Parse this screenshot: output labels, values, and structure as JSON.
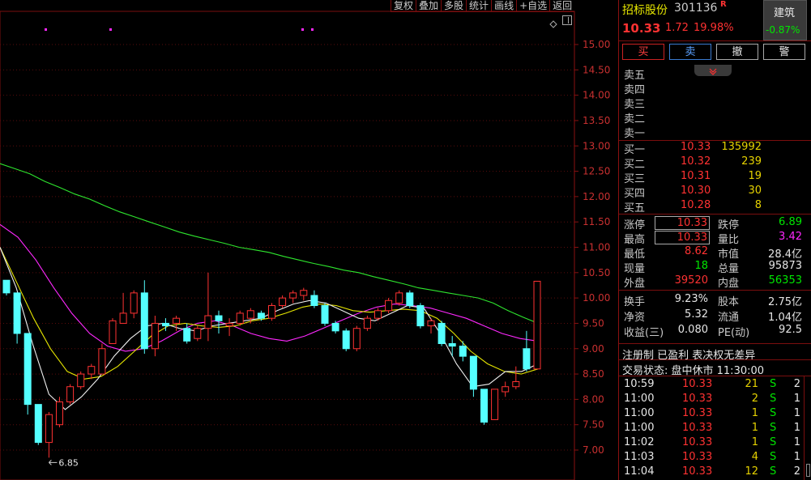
{
  "toolbar": [
    "复权",
    "叠加",
    "多股",
    "统计",
    "画线",
    "+自选",
    "返回"
  ],
  "chart": {
    "y_ticks": [
      "15.00",
      "14.50",
      "14.00",
      "13.50",
      "13.00",
      "12.50",
      "12.00",
      "11.50",
      "11.00",
      "10.50",
      "10.00",
      "9.50",
      "9.00",
      "8.50",
      "8.00",
      "7.50",
      "7.00"
    ],
    "low_marker": "6.85",
    "pin_icon": "diamond-icon"
  },
  "chart_data": {
    "type": "candlestick",
    "y_range": [
      6.7,
      15.2
    ],
    "candles": [
      {
        "o": 10.35,
        "h": 10.35,
        "l": 10.05,
        "c": 10.1
      },
      {
        "o": 10.1,
        "h": 10.1,
        "l": 9.1,
        "c": 9.3
      },
      {
        "o": 9.3,
        "h": 9.3,
        "l": 7.7,
        "c": 7.9
      },
      {
        "o": 7.9,
        "h": 7.9,
        "l": 7.1,
        "c": 7.15
      },
      {
        "o": 7.15,
        "h": 7.75,
        "l": 6.85,
        "c": 7.7
      },
      {
        "o": 7.5,
        "h": 8.05,
        "l": 7.45,
        "c": 7.95
      },
      {
        "o": 7.95,
        "h": 8.3,
        "l": 7.9,
        "c": 8.25
      },
      {
        "o": 8.25,
        "h": 8.55,
        "l": 8.2,
        "c": 8.5
      },
      {
        "o": 8.5,
        "h": 8.7,
        "l": 8.4,
        "c": 8.65
      },
      {
        "o": 8.5,
        "h": 9.1,
        "l": 8.5,
        "c": 9.0
      },
      {
        "o": 9.1,
        "h": 9.6,
        "l": 9.1,
        "c": 9.55
      },
      {
        "o": 9.5,
        "h": 10.1,
        "l": 9.5,
        "c": 9.7
      },
      {
        "o": 9.7,
        "h": 10.15,
        "l": 9.6,
        "c": 10.1
      },
      {
        "o": 10.1,
        "h": 10.35,
        "l": 8.9,
        "c": 9.0
      },
      {
        "o": 9.0,
        "h": 9.65,
        "l": 8.85,
        "c": 9.5
      },
      {
        "o": 9.5,
        "h": 9.6,
        "l": 9.35,
        "c": 9.45
      },
      {
        "o": 9.5,
        "h": 9.65,
        "l": 9.35,
        "c": 9.6
      },
      {
        "o": 9.4,
        "h": 9.5,
        "l": 9.1,
        "c": 9.15
      },
      {
        "o": 9.2,
        "h": 9.45,
        "l": 9.15,
        "c": 9.4
      },
      {
        "o": 9.4,
        "h": 10.5,
        "l": 9.15,
        "c": 9.65
      },
      {
        "o": 9.65,
        "h": 9.75,
        "l": 9.3,
        "c": 9.55
      },
      {
        "o": 9.45,
        "h": 9.6,
        "l": 9.25,
        "c": 9.5
      },
      {
        "o": 9.5,
        "h": 9.75,
        "l": 9.45,
        "c": 9.7
      },
      {
        "o": 9.6,
        "h": 9.8,
        "l": 9.5,
        "c": 9.75
      },
      {
        "o": 9.7,
        "h": 9.75,
        "l": 9.55,
        "c": 9.6
      },
      {
        "o": 9.6,
        "h": 9.9,
        "l": 9.55,
        "c": 9.85
      },
      {
        "o": 9.85,
        "h": 10.05,
        "l": 9.8,
        "c": 10.0
      },
      {
        "o": 10.0,
        "h": 10.15,
        "l": 9.9,
        "c": 10.1
      },
      {
        "o": 10.05,
        "h": 10.2,
        "l": 9.95,
        "c": 10.15
      },
      {
        "o": 10.05,
        "h": 10.15,
        "l": 9.8,
        "c": 9.85
      },
      {
        "o": 9.85,
        "h": 9.9,
        "l": 9.45,
        "c": 9.5
      },
      {
        "o": 9.5,
        "h": 9.55,
        "l": 9.3,
        "c": 9.35
      },
      {
        "o": 9.35,
        "h": 9.4,
        "l": 8.95,
        "c": 9.0
      },
      {
        "o": 9.0,
        "h": 9.45,
        "l": 8.95,
        "c": 9.4
      },
      {
        "o": 9.4,
        "h": 9.65,
        "l": 9.35,
        "c": 9.6
      },
      {
        "o": 9.6,
        "h": 9.8,
        "l": 9.55,
        "c": 9.75
      },
      {
        "o": 9.75,
        "h": 10.0,
        "l": 9.7,
        "c": 9.95
      },
      {
        "o": 9.9,
        "h": 10.15,
        "l": 9.85,
        "c": 10.1
      },
      {
        "o": 10.1,
        "h": 10.15,
        "l": 9.8,
        "c": 9.85
      },
      {
        "o": 9.85,
        "h": 9.9,
        "l": 9.4,
        "c": 9.45
      },
      {
        "o": 9.45,
        "h": 9.6,
        "l": 9.3,
        "c": 9.55
      },
      {
        "o": 9.5,
        "h": 9.55,
        "l": 9.05,
        "c": 9.1
      },
      {
        "o": 9.1,
        "h": 9.25,
        "l": 8.85,
        "c": 9.05
      },
      {
        "o": 9.05,
        "h": 9.15,
        "l": 8.75,
        "c": 8.85
      },
      {
        "o": 8.85,
        "h": 8.85,
        "l": 8.05,
        "c": 8.2
      },
      {
        "o": 8.2,
        "h": 8.2,
        "l": 7.5,
        "c": 7.55
      },
      {
        "o": 7.6,
        "h": 8.2,
        "l": 7.6,
        "c": 8.2
      },
      {
        "o": 8.15,
        "h": 8.35,
        "l": 8.05,
        "c": 8.25
      },
      {
        "o": 8.25,
        "h": 8.65,
        "l": 8.2,
        "c": 8.35
      },
      {
        "o": 9.0,
        "h": 9.35,
        "l": 8.55,
        "c": 8.6
      },
      {
        "o": 8.6,
        "h": 10.33,
        "l": 8.6,
        "c": 10.33
      }
    ],
    "ma_lines": [
      {
        "name": "green",
        "color": "#2ee62e",
        "points": [
          12.65,
          12.55,
          12.45,
          12.3,
          12.18,
          12.05,
          11.95,
          11.82,
          11.7,
          11.6,
          11.5,
          11.4,
          11.3,
          11.22,
          11.15,
          11.08,
          11.0,
          10.95,
          10.9,
          10.82,
          10.75,
          10.68,
          10.62,
          10.55,
          10.5,
          10.42,
          10.35,
          10.28,
          10.2,
          10.15,
          10.1,
          10.05,
          10.0,
          9.9,
          9.75,
          9.62,
          9.5
        ]
      },
      {
        "name": "magenta",
        "color": "#ff28ff",
        "points": [
          11.45,
          11.2,
          10.75,
          10.2,
          9.7,
          9.3,
          9.05,
          8.95,
          9.0,
          9.15,
          9.35,
          9.5,
          9.55,
          9.45,
          9.3,
          9.2,
          9.15,
          9.25,
          9.4,
          9.55,
          9.7,
          9.82,
          9.88,
          9.85,
          9.8,
          9.7,
          9.6,
          9.45,
          9.3,
          9.2,
          9.15
        ]
      },
      {
        "name": "yellow",
        "color": "#e6e600",
        "points": [
          11.0,
          10.3,
          9.6,
          9.0,
          8.55,
          8.4,
          8.45,
          8.65,
          8.95,
          9.25,
          9.45,
          9.5,
          9.45,
          9.42,
          9.45,
          9.55,
          9.6,
          9.7,
          9.82,
          9.88,
          9.85,
          9.75,
          9.72,
          9.75,
          9.78,
          9.75,
          9.6,
          9.3,
          8.95,
          8.7,
          8.55,
          8.5,
          8.6
        ]
      },
      {
        "name": "white",
        "color": "#f0f0f0",
        "points": [
          11.0,
          10.2,
          9.1,
          8.1,
          7.8,
          8.05,
          8.4,
          8.85,
          9.2,
          9.45,
          9.5,
          9.4,
          9.35,
          9.45,
          9.5,
          9.55,
          9.6,
          9.75,
          9.88,
          9.95,
          9.9,
          9.75,
          9.6,
          9.55,
          9.7,
          9.85,
          9.8,
          9.3,
          8.7,
          8.25,
          8.3,
          8.55,
          8.55,
          8.7
        ]
      }
    ],
    "low_label": {
      "value": 6.85
    }
  },
  "header": {
    "name": "招标股份",
    "code": "301136",
    "flag": "R",
    "price": "10.33",
    "change": "1.72",
    "change_pct": "19.98%",
    "sector_name": "建筑",
    "sector_pct": "-0.87%"
  },
  "actions": [
    "买",
    "卖",
    "撤",
    "警"
  ],
  "collapse_icon": "chevron-down-icon",
  "asks": [
    {
      "label": "卖五",
      "price": "",
      "vol": ""
    },
    {
      "label": "卖四",
      "price": "",
      "vol": ""
    },
    {
      "label": "卖三",
      "price": "",
      "vol": ""
    },
    {
      "label": "卖二",
      "price": "",
      "vol": ""
    },
    {
      "label": "卖一",
      "price": "",
      "vol": ""
    }
  ],
  "bids": [
    {
      "label": "买一",
      "price": "10.33",
      "vol": "135992"
    },
    {
      "label": "买二",
      "price": "10.32",
      "vol": "239"
    },
    {
      "label": "买三",
      "price": "10.31",
      "vol": "19"
    },
    {
      "label": "买四",
      "price": "10.30",
      "vol": "30"
    },
    {
      "label": "买五",
      "price": "10.28",
      "vol": "8"
    }
  ],
  "stats": [
    {
      "l1": "涨停",
      "v1": "10.33",
      "c1": "red",
      "box1": true,
      "l2": "跌停",
      "v2": "6.89",
      "c2": "green"
    },
    {
      "l1": "最高",
      "v1": "10.33",
      "c1": "red",
      "box1": true,
      "l2": "量比",
      "v2": "3.42",
      "c2": "magenta"
    },
    {
      "l1": "最低",
      "v1": "8.62",
      "c1": "red",
      "l2": "市值",
      "v2": "28.4亿",
      "c2": "white"
    },
    {
      "l1": "现量",
      "v1": "18",
      "c1": "green",
      "l2": "总量",
      "v2": "95873",
      "c2": "white"
    },
    {
      "l1": "外盘",
      "v1": "39520",
      "c1": "red",
      "l2": "内盘",
      "v2": "56353",
      "c2": "green"
    }
  ],
  "fund": [
    {
      "l1": "换手",
      "v1": "9.23%",
      "l2": "股本",
      "v2": "2.75亿"
    },
    {
      "l1": "净资",
      "v1": "5.32",
      "l2": "流通",
      "v2": "1.04亿"
    },
    {
      "l1": "收益(三)",
      "v1": "0.080",
      "l2": "PE(动)",
      "v2": "92.5"
    }
  ],
  "tags": "注册制 已盈利 表决权无差异",
  "status": "交易状态: 盘中休市 11:30:00",
  "ticks": [
    {
      "time": "10:59",
      "price": "10.33",
      "vol": "21",
      "side": "S",
      "n": "2"
    },
    {
      "time": "11:00",
      "price": "10.33",
      "vol": "2",
      "side": "S",
      "n": "1"
    },
    {
      "time": "11:00",
      "price": "10.33",
      "vol": "1",
      "side": "S",
      "n": "1"
    },
    {
      "time": "11:00",
      "price": "10.33",
      "vol": "1",
      "side": "S",
      "n": "1"
    },
    {
      "time": "11:02",
      "price": "10.33",
      "vol": "1",
      "side": "S",
      "n": "1"
    },
    {
      "time": "11:03",
      "price": "10.33",
      "vol": "4",
      "side": "S",
      "n": "1"
    },
    {
      "time": "11:04",
      "price": "10.33",
      "vol": "12",
      "side": "S",
      "n": "2"
    }
  ]
}
